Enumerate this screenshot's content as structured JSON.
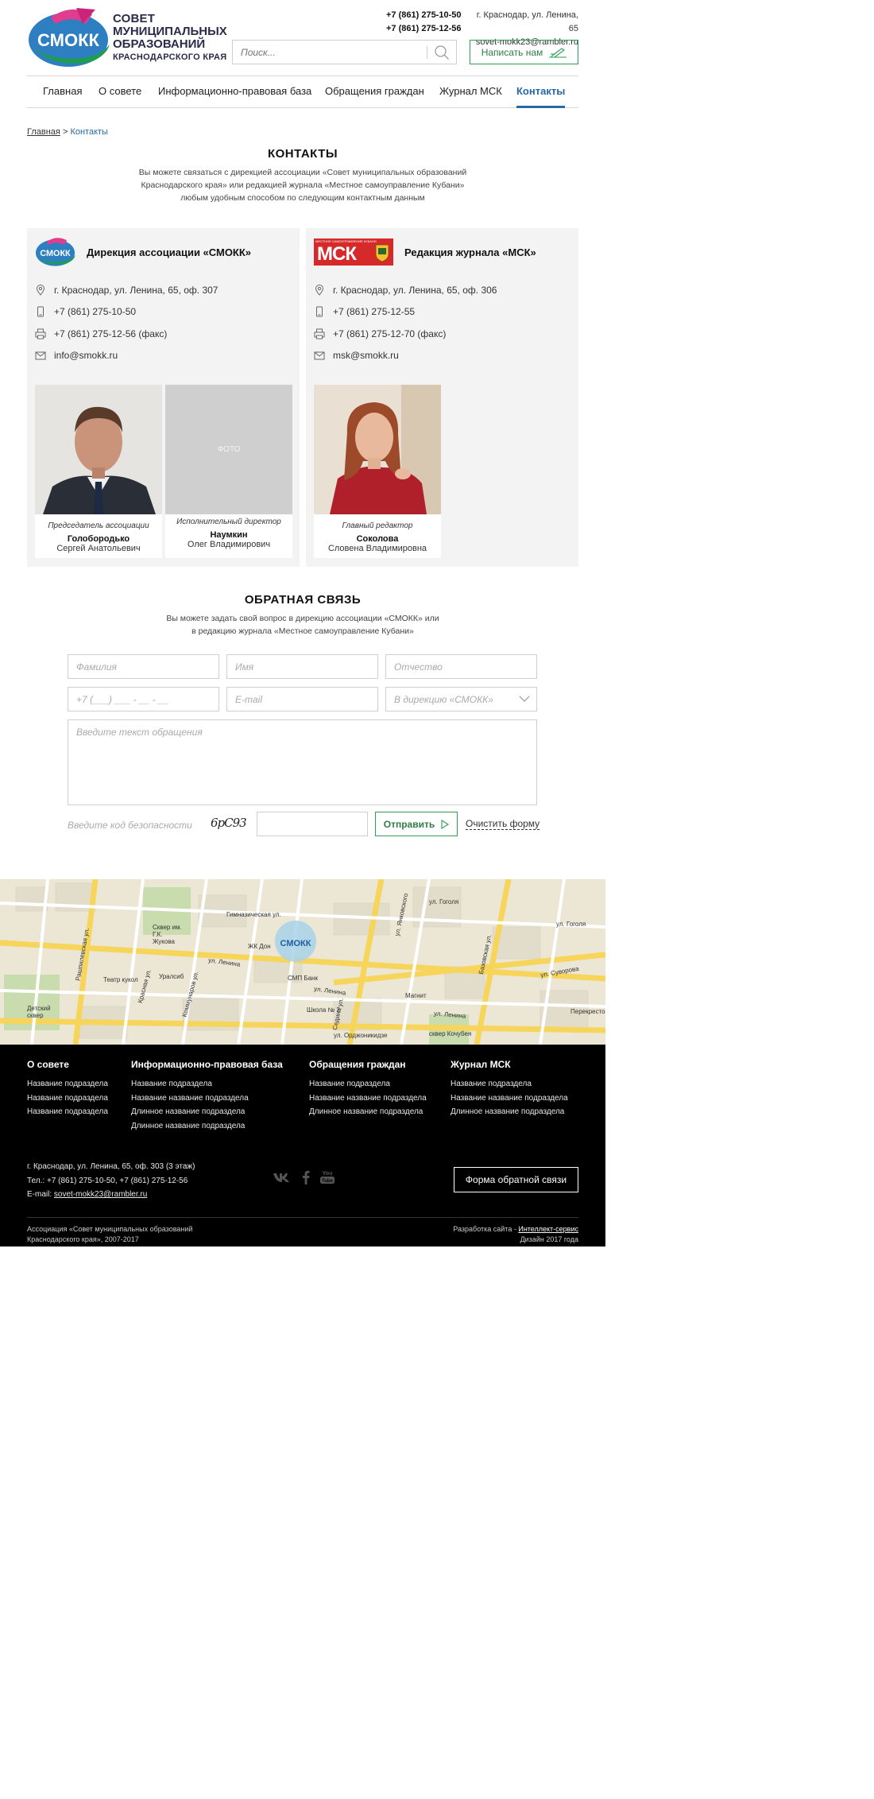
{
  "header": {
    "logo_word": "СМОКК",
    "logo_lines": [
      "СОВЕТ",
      "МУНИЦИПАЛЬНЫХ",
      "ОБРАЗОВАНИЙ",
      "КРАСНОДАРСКОГО КРАЯ"
    ],
    "phones": [
      "+7 (861) 275-10-50",
      "+7 (861) 275-12-56"
    ],
    "address": "г. Краснодар, ул. Ленина, 65",
    "email": "sovet-mokk23@rambler.ru",
    "search_placeholder": "Поиск...",
    "write_button": "Написать нам"
  },
  "nav": {
    "items": [
      "Главная",
      "О совете",
      "Информационно-правовая база",
      "Обращения граждан",
      "Журнал МСК",
      "Контакты"
    ],
    "active": "Контакты"
  },
  "breadcrumb": {
    "home": "Главная",
    "sep": ">",
    "current": "Контакты"
  },
  "contacts": {
    "title": "КОНТАКТЫ",
    "subtitle_lines": [
      "Вы можете связаться с дирекцией ассоциации «Совет муниципальных образований",
      "Краснодарского края» или редакцией журнала «Местное самоуправление Кубани»",
      "любым удобным способом по следующим контактным данным"
    ]
  },
  "card_smokk": {
    "logo_word": "СМОКК",
    "title": "Дирекция ассоциации «СМОКК»",
    "address": "г. Краснодар, ул. Ленина, 65, оф. 307",
    "phone": "+7 (861) 275-10-50",
    "fax": "+7 (861) 275-12-56 (факс)",
    "email": "info@smokk.ru",
    "people": [
      {
        "role": "Председатель ассоциации",
        "last": "Голобородько",
        "first": "Сергей Анатольевич"
      },
      {
        "role": "Исполнительный директор",
        "last": "Наумкин",
        "first": "Олег Владимирович",
        "photo_placeholder": "ФОТО"
      }
    ]
  },
  "card_msk": {
    "logo_small": "МЕСТНОЕ САМОУПРАВЛЕНИЕ КУБАНИ",
    "logo_big": "МСК",
    "title": "Редакция журнала «МСК»",
    "address": "г. Краснодар, ул. Ленина, 65, оф. 306",
    "phone": "+7 (861) 275-12-55",
    "fax": "+7 (861) 275-12-70 (факс)",
    "email": "msk@smokk.ru",
    "people": [
      {
        "role": "Главный редактор",
        "last": "Соколова",
        "first": "Словена Владимировна"
      }
    ]
  },
  "feedback": {
    "title": "ОБРАТНАЯ СВЯЗЬ",
    "subtitle_lines": [
      "Вы можете задать свой вопрос в дирекцию ассоциации «СМОКК» или",
      "в редакцию журнала «Местное самоуправление Кубани»"
    ],
    "placeholders": {
      "last_name": "Фамилия",
      "first_name": "Имя",
      "patronymic": "Отчество",
      "phone": "+7 (___) ___ - __ - __",
      "email": "E-mail",
      "message": "Введите текст обращения"
    },
    "recipient_selected": "В дирекцию «СМОКК»",
    "captcha_label": "Введите код безопасности",
    "captcha_code": "6рС93",
    "send_button": "Отправить",
    "clear_link": "Очистить форму"
  },
  "map": {
    "labels": [
      "Гимназическая ул.",
      "ул. Гоголя",
      "ул. Гоголя",
      "Сквер им. Г.К. Жукова",
      "ул. Ленина",
      "ул. Ленина",
      "ул. Ленина",
      "ул. Суворова",
      "ул. Орджоникидзе",
      "Красная ул.",
      "Рашпилевская ул.",
      "Коммунаров ул.",
      "Базовская ул.",
      "ул. Янковского",
      "Седина ул.",
      "Театр кукол",
      "Уралсиб",
      "СМП Банк",
      "Магнит",
      "Школа № 2",
      "Детский сквер",
      "ЖК Дон",
      "Перекресток",
      "сквер Кочубея"
    ]
  },
  "footer": {
    "columns": [
      {
        "heading": "О совете",
        "items": [
          "Название подраздела",
          "Название подраздела",
          "Название подраздела"
        ]
      },
      {
        "heading": "Информационно-правовая база",
        "items": [
          "Название подраздела",
          "Название название подраздела",
          "Длинное название подраздела",
          "Длинное название подраздела"
        ]
      },
      {
        "heading": "Обращения граждан",
        "items": [
          "Название подраздела",
          "Название название подраздела",
          "Длинное название подраздела"
        ]
      },
      {
        "heading": "Журнал МСК",
        "items": [
          "Название подраздела",
          "Название название подраздела",
          "Длинное название подраздела"
        ]
      }
    ],
    "address": "г. Краснодар, ул. Ленина, 65, оф. 303 (3 этаж)",
    "phones": "Тел.: +7 (861) 275-10-50,  +7 (861) 275-12-56",
    "email_label": "E-mail:",
    "email": "sovet-mokk23@rambler.ru",
    "feedback_button": "Форма обратной связи",
    "copyright_lines": [
      "Ассоциация «Совет муниципальных образований",
      "Краснодарского края», 2007-2017"
    ],
    "dev_label": "Разработка сайта -",
    "dev_link": "Интеллект-сервис",
    "design_year": "Дизайн 2017 года"
  },
  "colors": {
    "accent_blue": "#2569a8",
    "accent_green": "#2e9d55",
    "msk_red": "#d62a2a",
    "footer_bg": "#000000",
    "card_bg": "#f3f3f3"
  }
}
